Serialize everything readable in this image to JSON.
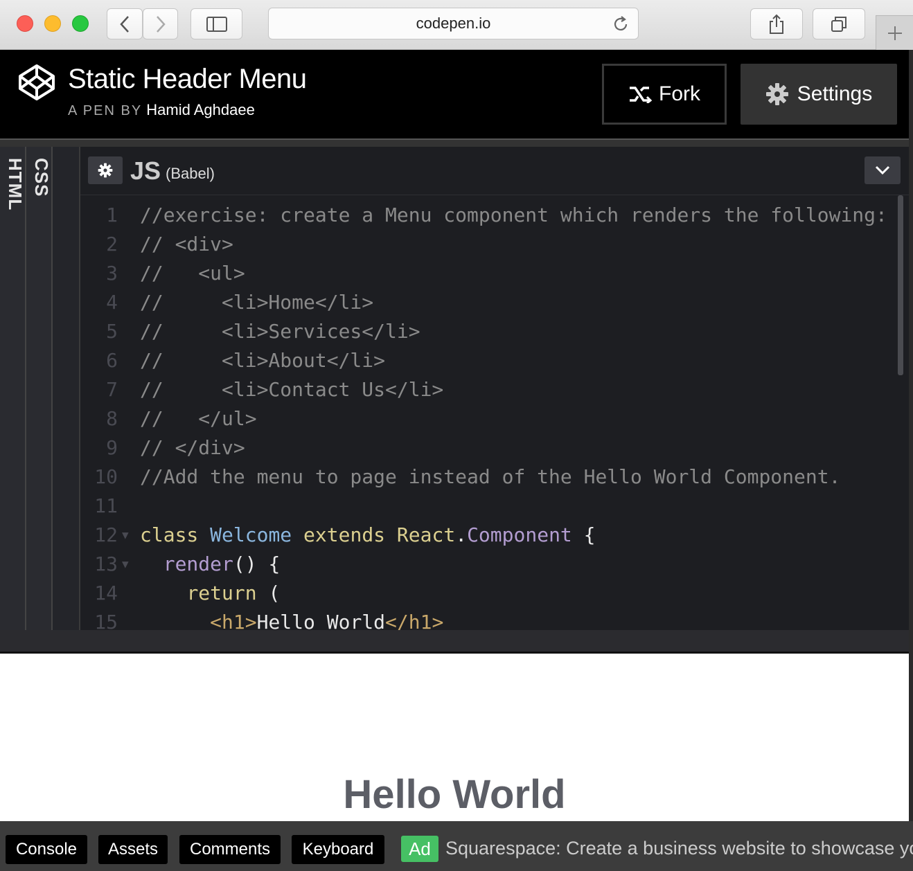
{
  "browser": {
    "url": "codepen.io"
  },
  "pen": {
    "title": "Static Header Menu",
    "by_prefix": "A PEN BY",
    "author": "Hamid Aghdaee",
    "fork_label": "Fork",
    "settings_label": "Settings"
  },
  "editor": {
    "side_tabs": [
      "HTML",
      "CSS"
    ],
    "panel_label": "JS",
    "panel_sublabel": "(Babel)",
    "lines": [
      {
        "n": "1",
        "text": "//exercise: create a Menu component which renders the following:"
      },
      {
        "n": "2",
        "text": "// <div>"
      },
      {
        "n": "3",
        "text": "//   <ul>"
      },
      {
        "n": "4",
        "text": "//     <li>Home</li>"
      },
      {
        "n": "5",
        "text": "//     <li>Services</li>"
      },
      {
        "n": "6",
        "text": "//     <li>About</li>"
      },
      {
        "n": "7",
        "text": "//     <li>Contact Us</li>"
      },
      {
        "n": "8",
        "text": "//   </ul>"
      },
      {
        "n": "9",
        "text": "// </div>"
      },
      {
        "n": "10",
        "text": "//Add the menu to page instead of the Hello World Component."
      },
      {
        "n": "11",
        "text": ""
      },
      {
        "n": "12",
        "text": "class Welcome extends React.Component {"
      },
      {
        "n": "13",
        "text": "  render() {"
      },
      {
        "n": "14",
        "text": "    return ("
      },
      {
        "n": "15",
        "text": "      <h1>Hello World</h1>"
      }
    ]
  },
  "preview": {
    "heading": "Hello World"
  },
  "footer": {
    "console": "Console",
    "assets": "Assets",
    "comments": "Comments",
    "keyboard": "Keyboard",
    "ad_tag": "Ad",
    "ad_text": "Squarespace: Create a business website to showcase yo"
  },
  "colors": {
    "accent_ad": "#46c064",
    "editor_bg": "#1d1e22"
  }
}
